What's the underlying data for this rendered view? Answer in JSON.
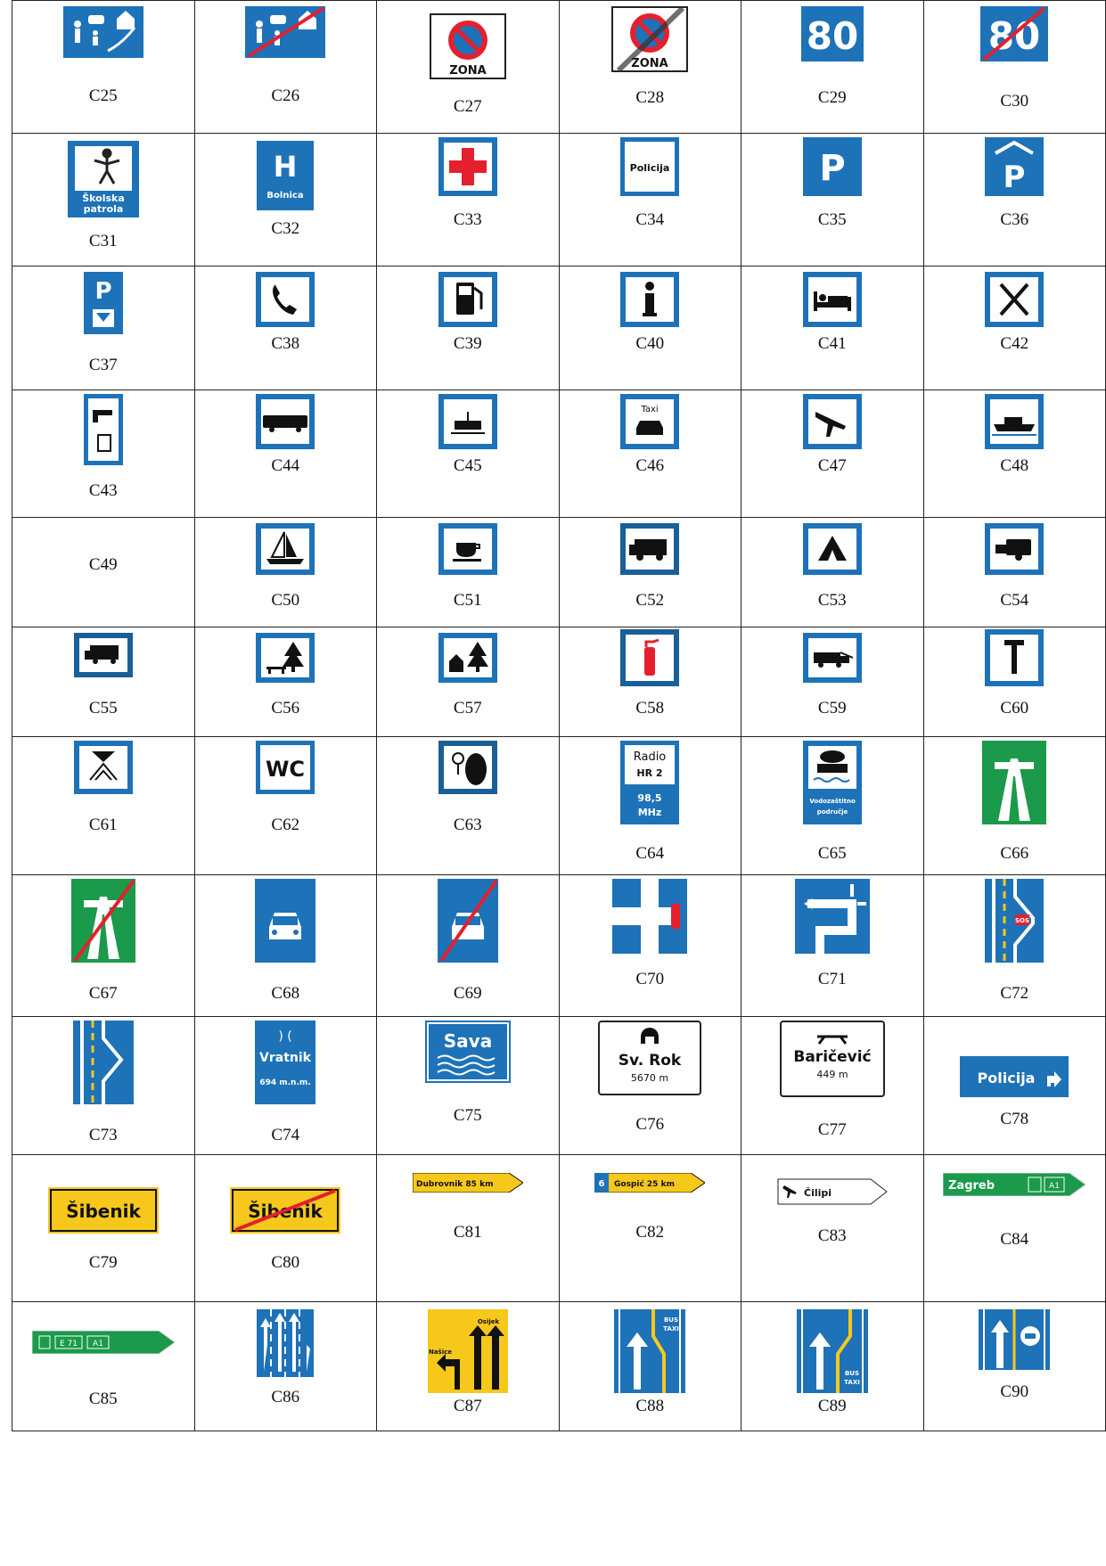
{
  "rows": [
    [
      "C25",
      "C26",
      "C27",
      "C28",
      "C29",
      "C30"
    ],
    [
      "C31",
      "C32",
      "C33",
      "C34",
      "C35",
      "C36"
    ],
    [
      "C37",
      "C38",
      "C39",
      "C40",
      "C41",
      "C42"
    ],
    [
      "C43",
      "C44",
      "C45",
      "C46",
      "C47",
      "C48"
    ],
    [
      "C49",
      "C50",
      "C51",
      "C52",
      "C53",
      "C54"
    ],
    [
      "C55",
      "C56",
      "C57",
      "C58",
      "C59",
      "C60"
    ],
    [
      "C61",
      "C62",
      "C63",
      "C64",
      "C65",
      "C66"
    ],
    [
      "C67",
      "C68",
      "C69",
      "C70",
      "C71",
      "C72"
    ],
    [
      "C73",
      "C74",
      "C75",
      "C76",
      "C77",
      "C78"
    ],
    [
      "C79",
      "C80",
      "C81",
      "C82",
      "C83",
      "C84"
    ],
    [
      "C85",
      "C86",
      "C87",
      "C88",
      "C89",
      "C90"
    ]
  ],
  "sign_text": {
    "zona": "ZONA",
    "speed": "80",
    "skolska_1": "Školska",
    "skolska_2": "patrola",
    "hospital_letter": "H",
    "bolnica": "Bolnica",
    "policija": "Policija",
    "parking": "P",
    "taxi": "Taxi",
    "wc": "WC",
    "radio_1": "Radio",
    "radio_2": "HR 2",
    "radio_3": "98,5",
    "radio_4": "MHz",
    "water_1": "Vodozaštitno",
    "water_2": "područje",
    "sos": "SOS",
    "pass_arrow": ") (",
    "pass_name": "Vratnik",
    "pass_alt": "694 m.n.m.",
    "river": "Sava",
    "tunnel_name": "Sv. Rok",
    "tunnel_len": "5670 m",
    "bridge_name": "Baričević",
    "bridge_len": "449 m",
    "police_dir": "Policija",
    "place_name": "Šibenik",
    "dir1": "Dubrovnik 85 km",
    "dir2_num": "6",
    "dir2": "Gospić 25 km",
    "dir3": "Čilipi",
    "dir4": "Zagreb",
    "dir4_a1": "A1",
    "dir5_e": "E 71",
    "dir5_a": "A1",
    "lane_left": "Našice",
    "lane_right": "Osijek",
    "bus": "BUS",
    "taxi_lane": "TAXI"
  },
  "colors": {
    "blue": "#1e72b8",
    "red": "#e4202e",
    "green": "#1a9a4a",
    "yellow": "#f7c81c"
  }
}
